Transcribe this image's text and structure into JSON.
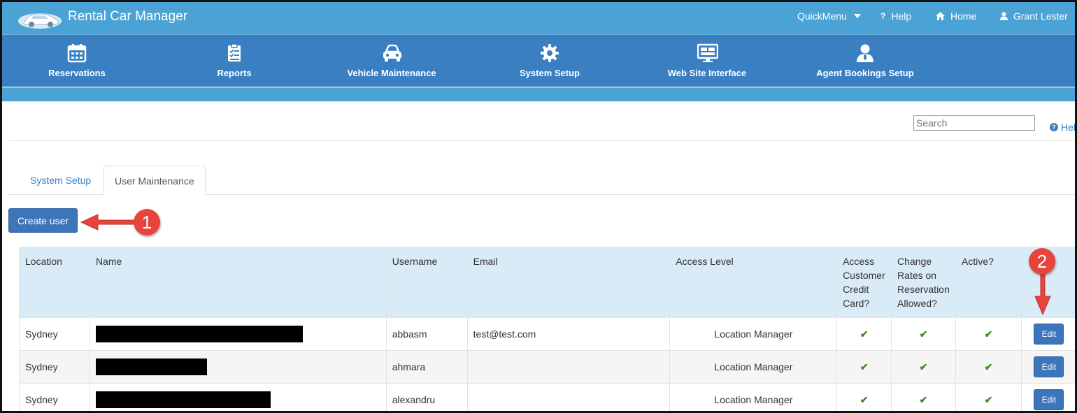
{
  "header": {
    "app_title": "Rental Car Manager",
    "quickmenu": "QuickMenu",
    "help": "Help",
    "home": "Home",
    "user": "Grant Lester"
  },
  "nav": {
    "items": [
      {
        "label": "Reservations",
        "icon": "calendar-icon"
      },
      {
        "label": "Reports",
        "icon": "clipboard-icon"
      },
      {
        "label": "Vehicle Maintenance",
        "icon": "car-icon"
      },
      {
        "label": "System Setup",
        "icon": "gear-icon"
      },
      {
        "label": "Web Site Interface",
        "icon": "monitor-icon"
      },
      {
        "label": "Agent Bookings Setup",
        "icon": "person-icon"
      }
    ]
  },
  "toolbar": {
    "search_placeholder": "Search",
    "help_link": "Hel"
  },
  "tabs": [
    {
      "label": "System Setup",
      "active": false
    },
    {
      "label": "User Maintenance",
      "active": true
    }
  ],
  "create_user_label": "Create user",
  "table": {
    "headers": {
      "location": "Location",
      "name": "Name",
      "username": "Username",
      "email": "Email",
      "access_level": "Access Level",
      "access_cc": "Access Customer Credit Card?",
      "change_rates": "Change Rates on Reservation Allowed?",
      "active": "Active?"
    },
    "rows": [
      {
        "location": "Sydney",
        "username": "abbasm",
        "email": "test@test.com",
        "access_level": "Location Manager",
        "access_cc": "✔",
        "change_rates": "✔",
        "active": "✔",
        "edit": "Edit"
      },
      {
        "location": "Sydney",
        "username": "ahmara",
        "email": "",
        "access_level": "Location Manager",
        "access_cc": "✔",
        "change_rates": "✔",
        "active": "✔",
        "edit": "Edit"
      },
      {
        "location": "Sydney",
        "username": "alexandru",
        "email": "",
        "access_level": "Location Manager",
        "access_cc": "✔",
        "change_rates": "✔",
        "active": "✔",
        "edit": "Edit"
      }
    ]
  },
  "annotations": {
    "callout_1": "1",
    "callout_2": "2"
  },
  "colors": {
    "topbar": "#4aa3d4",
    "mainnav": "#3a7fc2",
    "button": "#3d75ba",
    "callout": "#e8443b",
    "check": "#3c8a1e"
  }
}
